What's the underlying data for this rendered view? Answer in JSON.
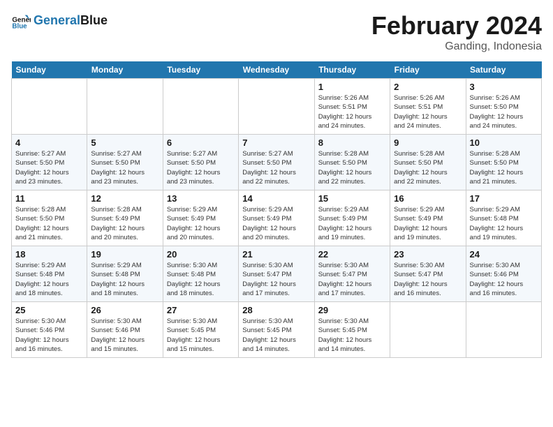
{
  "header": {
    "logo_line1": "General",
    "logo_line2": "Blue",
    "month": "February 2024",
    "location": "Ganding, Indonesia"
  },
  "columns": [
    "Sunday",
    "Monday",
    "Tuesday",
    "Wednesday",
    "Thursday",
    "Friday",
    "Saturday"
  ],
  "weeks": [
    [
      {
        "day": "",
        "info": ""
      },
      {
        "day": "",
        "info": ""
      },
      {
        "day": "",
        "info": ""
      },
      {
        "day": "",
        "info": ""
      },
      {
        "day": "1",
        "info": "Sunrise: 5:26 AM\nSunset: 5:51 PM\nDaylight: 12 hours\nand 24 minutes."
      },
      {
        "day": "2",
        "info": "Sunrise: 5:26 AM\nSunset: 5:51 PM\nDaylight: 12 hours\nand 24 minutes."
      },
      {
        "day": "3",
        "info": "Sunrise: 5:26 AM\nSunset: 5:50 PM\nDaylight: 12 hours\nand 24 minutes."
      }
    ],
    [
      {
        "day": "4",
        "info": "Sunrise: 5:27 AM\nSunset: 5:50 PM\nDaylight: 12 hours\nand 23 minutes."
      },
      {
        "day": "5",
        "info": "Sunrise: 5:27 AM\nSunset: 5:50 PM\nDaylight: 12 hours\nand 23 minutes."
      },
      {
        "day": "6",
        "info": "Sunrise: 5:27 AM\nSunset: 5:50 PM\nDaylight: 12 hours\nand 23 minutes."
      },
      {
        "day": "7",
        "info": "Sunrise: 5:27 AM\nSunset: 5:50 PM\nDaylight: 12 hours\nand 22 minutes."
      },
      {
        "day": "8",
        "info": "Sunrise: 5:28 AM\nSunset: 5:50 PM\nDaylight: 12 hours\nand 22 minutes."
      },
      {
        "day": "9",
        "info": "Sunrise: 5:28 AM\nSunset: 5:50 PM\nDaylight: 12 hours\nand 22 minutes."
      },
      {
        "day": "10",
        "info": "Sunrise: 5:28 AM\nSunset: 5:50 PM\nDaylight: 12 hours\nand 21 minutes."
      }
    ],
    [
      {
        "day": "11",
        "info": "Sunrise: 5:28 AM\nSunset: 5:50 PM\nDaylight: 12 hours\nand 21 minutes."
      },
      {
        "day": "12",
        "info": "Sunrise: 5:28 AM\nSunset: 5:49 PM\nDaylight: 12 hours\nand 20 minutes."
      },
      {
        "day": "13",
        "info": "Sunrise: 5:29 AM\nSunset: 5:49 PM\nDaylight: 12 hours\nand 20 minutes."
      },
      {
        "day": "14",
        "info": "Sunrise: 5:29 AM\nSunset: 5:49 PM\nDaylight: 12 hours\nand 20 minutes."
      },
      {
        "day": "15",
        "info": "Sunrise: 5:29 AM\nSunset: 5:49 PM\nDaylight: 12 hours\nand 19 minutes."
      },
      {
        "day": "16",
        "info": "Sunrise: 5:29 AM\nSunset: 5:49 PM\nDaylight: 12 hours\nand 19 minutes."
      },
      {
        "day": "17",
        "info": "Sunrise: 5:29 AM\nSunset: 5:48 PM\nDaylight: 12 hours\nand 19 minutes."
      }
    ],
    [
      {
        "day": "18",
        "info": "Sunrise: 5:29 AM\nSunset: 5:48 PM\nDaylight: 12 hours\nand 18 minutes."
      },
      {
        "day": "19",
        "info": "Sunrise: 5:29 AM\nSunset: 5:48 PM\nDaylight: 12 hours\nand 18 minutes."
      },
      {
        "day": "20",
        "info": "Sunrise: 5:30 AM\nSunset: 5:48 PM\nDaylight: 12 hours\nand 18 minutes."
      },
      {
        "day": "21",
        "info": "Sunrise: 5:30 AM\nSunset: 5:47 PM\nDaylight: 12 hours\nand 17 minutes."
      },
      {
        "day": "22",
        "info": "Sunrise: 5:30 AM\nSunset: 5:47 PM\nDaylight: 12 hours\nand 17 minutes."
      },
      {
        "day": "23",
        "info": "Sunrise: 5:30 AM\nSunset: 5:47 PM\nDaylight: 12 hours\nand 16 minutes."
      },
      {
        "day": "24",
        "info": "Sunrise: 5:30 AM\nSunset: 5:46 PM\nDaylight: 12 hours\nand 16 minutes."
      }
    ],
    [
      {
        "day": "25",
        "info": "Sunrise: 5:30 AM\nSunset: 5:46 PM\nDaylight: 12 hours\nand 16 minutes."
      },
      {
        "day": "26",
        "info": "Sunrise: 5:30 AM\nSunset: 5:46 PM\nDaylight: 12 hours\nand 15 minutes."
      },
      {
        "day": "27",
        "info": "Sunrise: 5:30 AM\nSunset: 5:45 PM\nDaylight: 12 hours\nand 15 minutes."
      },
      {
        "day": "28",
        "info": "Sunrise: 5:30 AM\nSunset: 5:45 PM\nDaylight: 12 hours\nand 14 minutes."
      },
      {
        "day": "29",
        "info": "Sunrise: 5:30 AM\nSunset: 5:45 PM\nDaylight: 12 hours\nand 14 minutes."
      },
      {
        "day": "",
        "info": ""
      },
      {
        "day": "",
        "info": ""
      }
    ]
  ]
}
